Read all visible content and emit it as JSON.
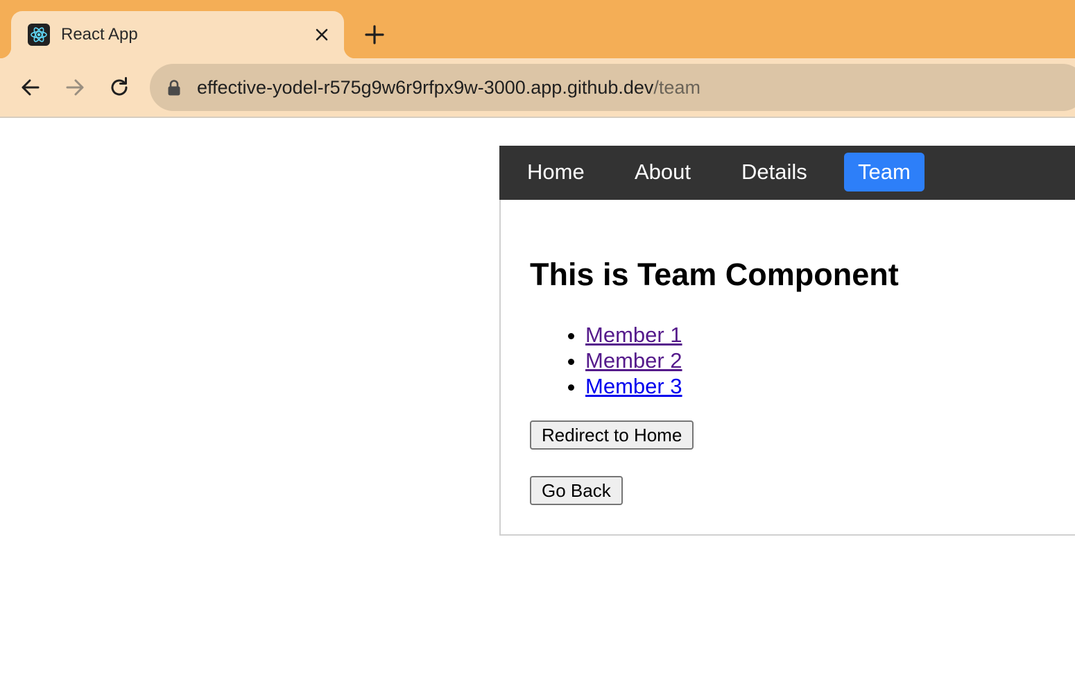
{
  "browser": {
    "tab": {
      "title": "React App",
      "favicon": "react-logo-icon"
    },
    "new_tab_icon": "plus-icon",
    "nav": {
      "back": "arrow-left-icon",
      "forward": "arrow-right-icon",
      "reload": "reload-icon"
    },
    "address": {
      "host": "effective-yodel-r575g9w6r9rfpx9w-3000.app.github.dev",
      "path": "/team",
      "lock": "lock-icon"
    }
  },
  "navbar": {
    "links": [
      {
        "label": "Home",
        "active": false
      },
      {
        "label": "About",
        "active": false
      },
      {
        "label": "Details",
        "active": false
      },
      {
        "label": "Team",
        "active": true
      }
    ],
    "background": "#333333",
    "active_color": "#2d7ff9"
  },
  "content": {
    "heading": "This is Team Component",
    "members": [
      {
        "label": "Member 1",
        "visited": true
      },
      {
        "label": "Member 2",
        "visited": true
      },
      {
        "label": "Member 3",
        "visited": false
      }
    ],
    "redirect_button": "Redirect to Home",
    "back_button": "Go Back"
  },
  "colors": {
    "tabstrip": "#f4ae56",
    "toolbar": "#fadfbd",
    "omnibox": "#dcc5a6",
    "visited_link": "#551a8b",
    "unvisited_link": "#0000ee"
  }
}
